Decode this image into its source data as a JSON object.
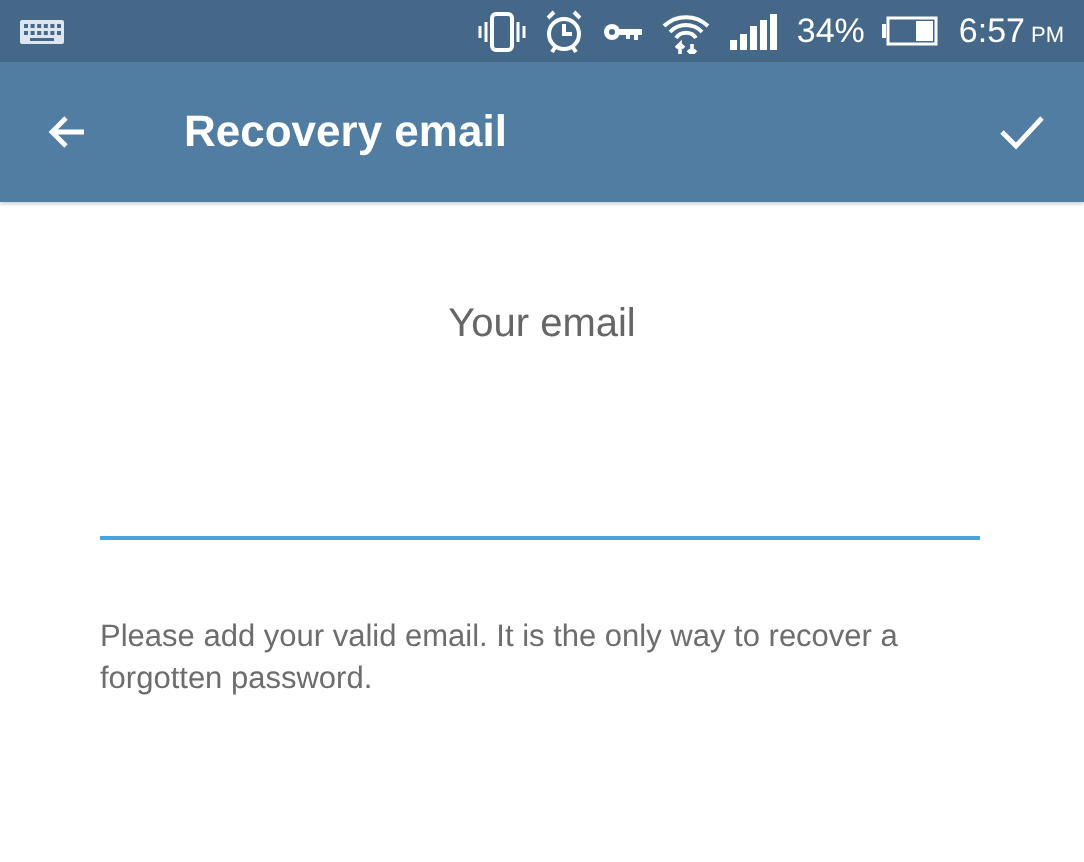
{
  "status_bar": {
    "battery_percent": "34%",
    "time": "6:57",
    "meridiem": "PM"
  },
  "app_bar": {
    "title": "Recovery email"
  },
  "form": {
    "heading": "Your email",
    "field": {
      "focused": true
    },
    "hint": "Please add your valid email. It is the only way to recover a forgotten password."
  }
}
